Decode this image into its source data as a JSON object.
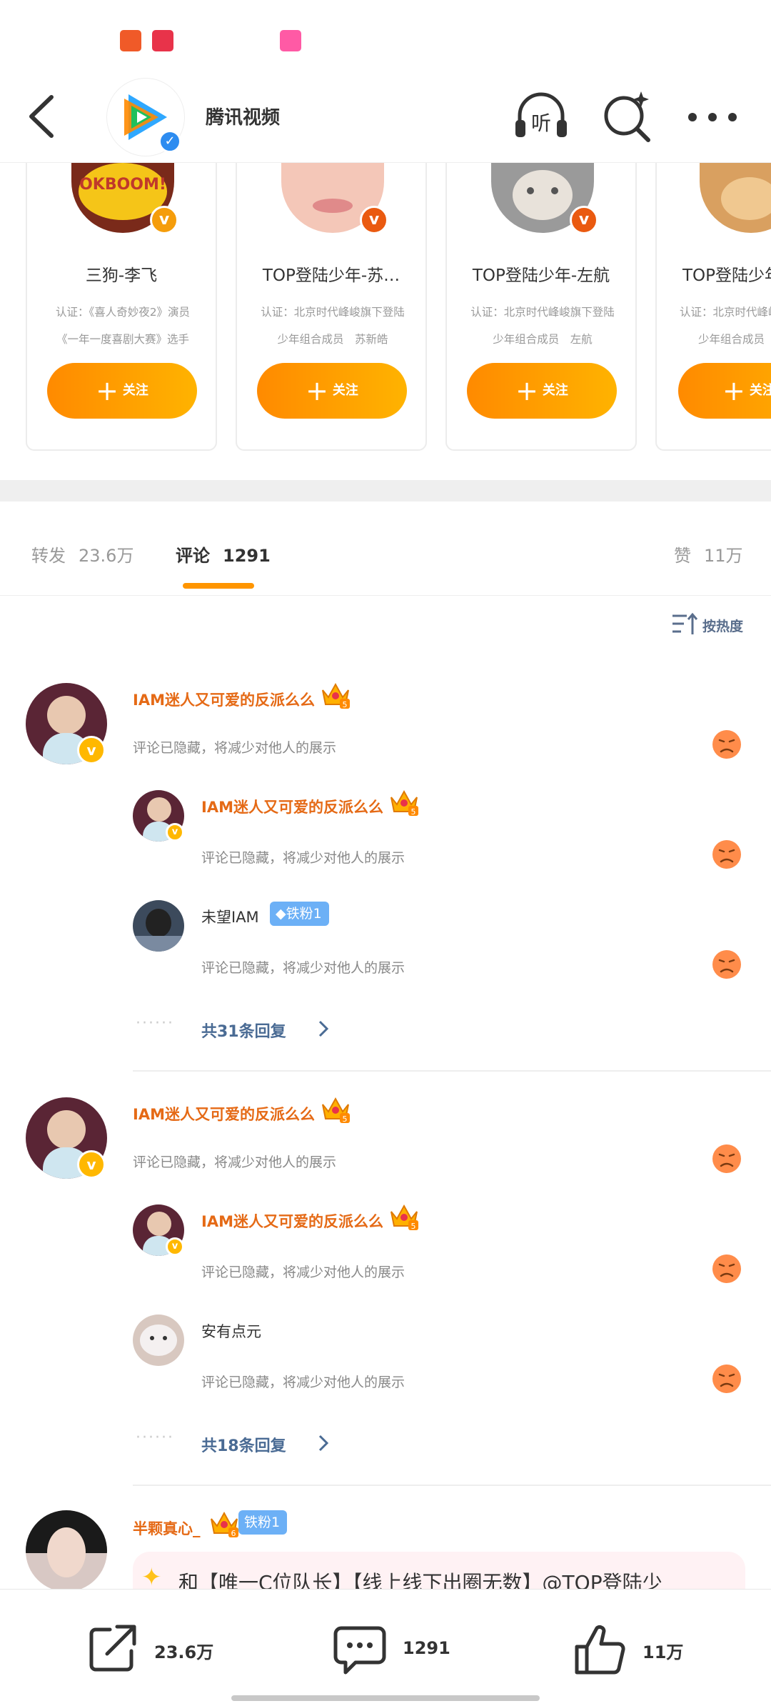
{
  "header": {
    "account_name": "腾讯视频",
    "listen_label": "听"
  },
  "recommend_cards": [
    {
      "name": "三狗-李飞",
      "desc1": "认证：《喜人奇妙夜2》演员",
      "desc2": "《一年一度喜剧大赛》选手",
      "follow_label": "关注",
      "avatar_text": "OKBOOM!"
    },
    {
      "name": "TOP登陆少年-苏…",
      "desc1": "认证：北京时代峰峻旗下登陆",
      "desc2": "少年组合成员　苏新皓",
      "follow_label": "关注"
    },
    {
      "name": "TOP登陆少年-左航",
      "desc1": "认证：北京时代峰峻旗下登陆",
      "desc2": "少年组合成员　左航",
      "follow_label": "关注"
    },
    {
      "name": "TOP登陆少年",
      "desc1": "认证：北京时代峰峻",
      "desc2": "少年组合成员",
      "follow_label": "关注"
    }
  ],
  "tabs": [
    {
      "label": "转发",
      "count": "23.6万"
    },
    {
      "label": "评论",
      "count": "1291"
    },
    {
      "label": "赞",
      "count": "11万"
    }
  ],
  "sort_label": "按热度",
  "comments": [
    {
      "username": "IAM迷人又可爱的反派么么",
      "text": "评论已隐藏，将减少对他人的展示",
      "replies": [
        {
          "username": "IAM迷人又可爱的反派么么",
          "text": "评论已隐藏，将减少对他人的展示"
        },
        {
          "username": "未望IAM",
          "badge": "铁粉1",
          "text": "评论已隐藏，将减少对他人的展示"
        }
      ],
      "more_replies": "共31条回复"
    },
    {
      "username": "IAM迷人又可爱的反派么么",
      "text": "评论已隐藏，将减少对他人的展示",
      "replies": [
        {
          "username": "IAM迷人又可爱的反派么么",
          "text": "评论已隐藏，将减少对他人的展示"
        },
        {
          "username": "安有点元",
          "text": "评论已隐藏，将减少对他人的展示"
        }
      ],
      "more_replies": "共18条回复"
    },
    {
      "username": "半颗真心_",
      "badge": "铁粉1",
      "crown_level": "6",
      "text": "和【唯一C位队长】【线上线下出圈无数】@TOP登陆少"
    }
  ],
  "crown_level": "5",
  "bottom_bar": {
    "repost": "23.6万",
    "comment": "1291",
    "like": "11万"
  },
  "colors": {
    "accent": "#ff9500",
    "username": "#e56a16",
    "link": "#4a6b94"
  }
}
